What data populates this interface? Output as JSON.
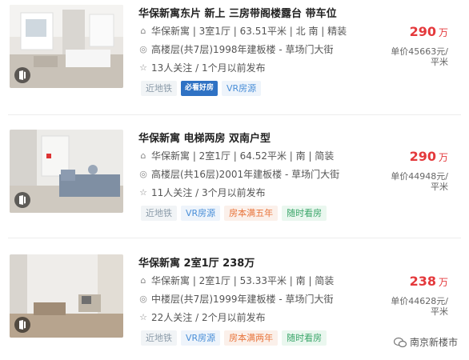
{
  "listings": [
    {
      "title": "华保新寓东片 新上 三房带阁楼露台 带车位",
      "info": "华保新寓 | 3室1厅 | 63.51平米 | 北 南 | 精装",
      "floor": "高楼层(共7层)1998年建板楼 - 草场门大街",
      "follow": "13人关注 / 1个月以前发布",
      "tags": [
        "近地铁",
        "必看好房",
        "VR房源"
      ],
      "price": "290",
      "price_unit": "万",
      "unit_price_line1": "单价45663元/",
      "unit_price_line2": "平米"
    },
    {
      "title": "华保新寓 电梯两房 双南户型",
      "info": "华保新寓 | 2室1厅 | 64.52平米 | 南 | 简装",
      "floor": "高楼层(共16层)2001年建板楼 - 草场门大街",
      "follow": "11人关注 / 3个月以前发布",
      "tags": [
        "近地铁",
        "VR房源",
        "房本满五年",
        "随时看房"
      ],
      "price": "290",
      "price_unit": "万",
      "unit_price_line1": "单价44948元/",
      "unit_price_line2": "平米"
    },
    {
      "title": "华保新寓 2室1厅 238万",
      "info": "华保新寓 | 2室1厅 | 53.33平米 | 南 | 简装",
      "floor": "中楼层(共7层)1999年建板楼 - 草场门大街",
      "follow": "22人关注 / 2个月以前发布",
      "tags": [
        "近地铁",
        "VR房源",
        "房本满两年",
        "随时看房"
      ],
      "price": "238",
      "price_unit": "万",
      "unit_price_line1": "单价44628元/",
      "unit_price_line2": "平米"
    }
  ],
  "watermark": "南京新楼市",
  "colors": {
    "price": "#e4393c",
    "brand_tag": "#2f72c4"
  }
}
